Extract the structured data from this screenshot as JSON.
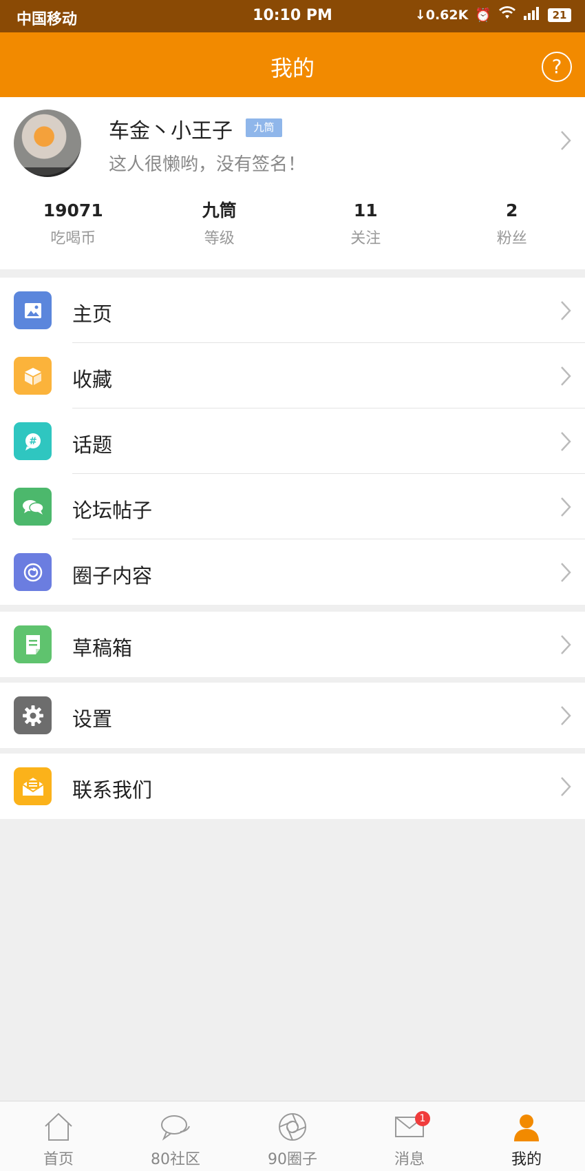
{
  "status_bar": {
    "carrier": "中国移动",
    "time": "10:10 PM",
    "net_speed": "0.62K",
    "battery": "21"
  },
  "header": {
    "title": "我的",
    "help_icon": "?"
  },
  "profile": {
    "username": "车金丶小王子",
    "badge": "九筒",
    "signature": "这人很懒哟，没有签名！",
    "stats": [
      {
        "value": "19071",
        "label": "吃喝币"
      },
      {
        "value": "九筒",
        "label": "等级"
      },
      {
        "value": "11",
        "label": "关注"
      },
      {
        "value": "2",
        "label": "粉丝"
      }
    ]
  },
  "menu": {
    "group1": [
      {
        "label": "主页",
        "icon": "image-icon",
        "color": "#5b86dc"
      },
      {
        "label": "收藏",
        "icon": "box-icon",
        "color": "#fbb33b"
      },
      {
        "label": "话题",
        "icon": "hashtag-bubble-icon",
        "color": "#2fc6c0"
      },
      {
        "label": "论坛帖子",
        "icon": "chat-bubbles-icon",
        "color": "#4cb86c"
      },
      {
        "label": "圈子内容",
        "icon": "swirl-icon",
        "color": "#6b7de0"
      }
    ],
    "group2": [
      {
        "label": "草稿箱",
        "icon": "document-icon",
        "color": "#5fc36e"
      }
    ],
    "group3": [
      {
        "label": "设置",
        "icon": "gear-icon",
        "color": "#6d6d6d"
      }
    ],
    "group4": [
      {
        "label": "联系我们",
        "icon": "envelope-icon",
        "color": "#fbb21a"
      }
    ]
  },
  "tabbar": {
    "items": [
      {
        "label": "首页",
        "icon": "home-icon"
      },
      {
        "label": "80社区",
        "icon": "chat-icon"
      },
      {
        "label": "90圈子",
        "icon": "aperture-icon"
      },
      {
        "label": "消息",
        "icon": "mail-icon",
        "badge": "1"
      },
      {
        "label": "我的",
        "icon": "person-icon",
        "active": true
      }
    ],
    "active_color": "#f28a00"
  }
}
